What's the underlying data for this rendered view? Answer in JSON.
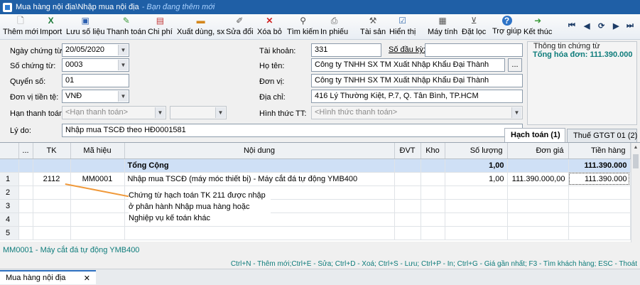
{
  "title": {
    "main": "Mua hàng nội địa\\Nhập mua nội địa",
    "mode": "- Bạn đang thêm mới"
  },
  "toolbar": {
    "items": [
      {
        "label": "Thêm mới",
        "icon": "new-doc-icon"
      },
      {
        "label": "Import",
        "icon": "excel-icon"
      },
      {
        "label": "Lưu số liệu",
        "icon": "save-icon"
      },
      {
        "label": "Thanh toán",
        "icon": "payment-icon"
      },
      {
        "label": "Chi phí",
        "icon": "cost-icon"
      },
      {
        "label": "Xuất dùng, sx",
        "icon": "export-use-icon"
      },
      {
        "label": "Sửa đổi",
        "icon": "edit-icon"
      },
      {
        "label": "Xóa bỏ",
        "icon": "delete-icon"
      },
      {
        "label": "Tìm kiếm",
        "icon": "search-icon"
      },
      {
        "label": "In phiếu",
        "icon": "print-icon"
      },
      {
        "label": "Tài sản",
        "icon": "asset-icon"
      },
      {
        "label": "Hiển thị",
        "icon": "display-icon"
      },
      {
        "label": "Máy tính",
        "icon": "calculator-icon"
      },
      {
        "label": "Đặt lọc",
        "icon": "filter-icon"
      },
      {
        "label": "Trợ giúp",
        "icon": "help-icon"
      },
      {
        "label": "Kết thúc",
        "icon": "exit-icon"
      }
    ],
    "nav": {
      "first": "⏮",
      "prev": "◀",
      "refresh": "⟳",
      "next": "▶",
      "last": "⏭"
    }
  },
  "form": {
    "ngay_chung_tu": {
      "label": "Ngày chứng từ:",
      "value": "20/05/2020"
    },
    "so_chung_tu": {
      "label": "Số chứng từ:",
      "value": "0003"
    },
    "quyen_so": {
      "label": "Quyển số:",
      "value": "01"
    },
    "don_vi_tien_te": {
      "label": "Đơn vị tiền tệ:",
      "value": "VNĐ"
    },
    "han_thanh_toan": {
      "label": "Hạn thanh toán:",
      "placeholder": "<Hạn thanh toán>"
    },
    "ly_do": {
      "label": "Lý do:",
      "value": "Nhập mua TSCĐ theo HĐ0001581"
    },
    "tai_khoan": {
      "label": "Tài khoản:",
      "value": "331"
    },
    "so_dau_ky": {
      "label": "Số đầu kỳ:"
    },
    "ho_ten": {
      "label": "Họ tên:",
      "value": "Công ty TNHH SX TM Xuất Nhập Khẩu Đại Thành"
    },
    "don_vi": {
      "label": "Đơn vị:",
      "value": "Công ty TNHH SX TM Xuất Nhập Khẩu Đại Thành"
    },
    "dia_chi": {
      "label": "Địa chỉ:",
      "value": "416 Lý Thường Kiệt, P.7, Q. Tân Bình, TP.HCM"
    },
    "hinh_thuc_tt": {
      "label": "Hình thức TT:",
      "placeholder": "<Hình thức thanh toán>"
    },
    "ellipsis": "..."
  },
  "info": {
    "header": "Thông tin chứng từ",
    "total": "Tổng hóa đơn: 111.390.000"
  },
  "tabs": {
    "hach_toan": "Hạch toán (1)",
    "thue": "Thuế GTGT 01 (2)"
  },
  "grid": {
    "columns": [
      "...",
      "TK",
      "Mã hiệu",
      "Nội dung",
      "ĐVT",
      "Kho",
      "Số lượng",
      "Đơn giá",
      "Tiền hàng"
    ],
    "total_row": {
      "label": "Tổng Cộng",
      "so_luong": "1,00",
      "tien_hang": "111.390.000"
    },
    "rows": [
      {
        "n": "1",
        "tk": "2112",
        "ma": "MM0001",
        "noi_dung": "Nhập mua TSCĐ (máy móc thiết bị) - Máy cắt đá tự động YMB400",
        "dvt": "",
        "kho": "",
        "so_luong": "1,00",
        "don_gia": "111.390.000,00",
        "tien_hang": "111.390.000"
      },
      {
        "n": "2"
      },
      {
        "n": "3"
      },
      {
        "n": "4"
      },
      {
        "n": "5"
      }
    ]
  },
  "annotation": "Chứng từ hạch toán TK 211 được nhập ở phân hành Nhập mua hàng hoặc Nghiệp vụ kế toán khác",
  "status": "MM0001 - Máy cắt đá tự động YMB400",
  "hotkeys": "Ctrl+N - Thêm mới;Ctrl+E - Sửa; Ctrl+D - Xoá; Ctrl+S - Lưu; Ctrl+P - In; Ctrl+G - Giá gần nhất; F3 - Tìm khách hàng; ESC - Thoát",
  "bottom_tab": {
    "label": "Mua hàng nội địa",
    "close": "✕"
  },
  "colors": {
    "title_bar": "#1f5fa6",
    "accent_teal": "#0e7c7b",
    "total_row": "#cfe0f6",
    "annotation_line": "#f0993a"
  }
}
